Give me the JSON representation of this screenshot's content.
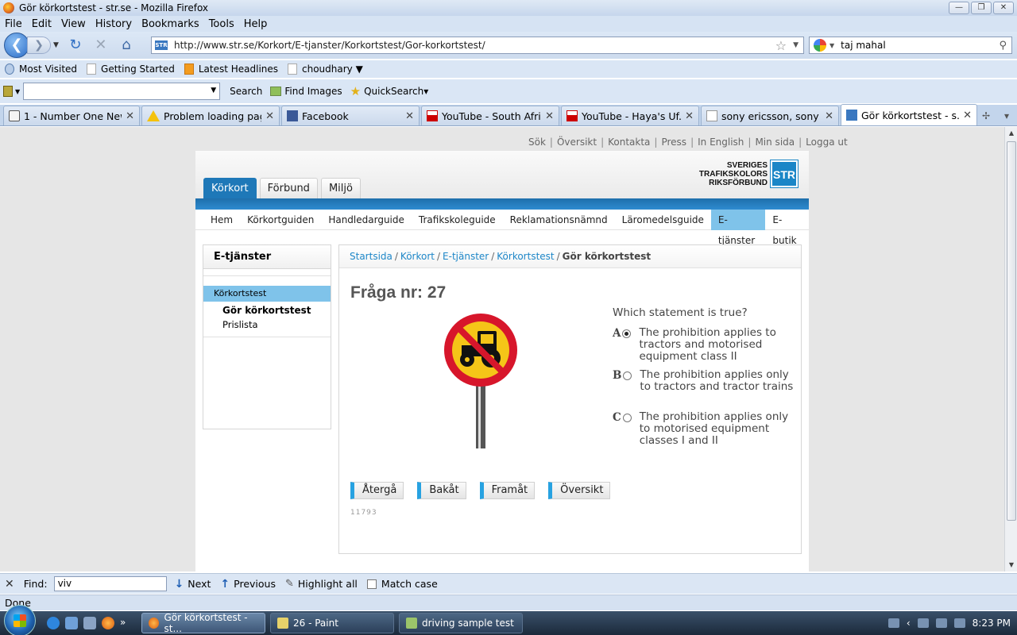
{
  "window": {
    "title": "Gör körkortstest - str.se - Mozilla Firefox",
    "buttons": [
      "minimize",
      "maximize",
      "close"
    ]
  },
  "menu": [
    "File",
    "Edit",
    "View",
    "History",
    "Bookmarks",
    "Tools",
    "Help"
  ],
  "nav": {
    "url": "http://www.str.se/Korkort/E-tjanster/Korkortstest/Gor-korkortstest/",
    "search_value": "taj mahal",
    "site_icon_text": "STR"
  },
  "bookmarks": [
    "Most Visited",
    "Getting Started",
    "Latest Headlines",
    "choudhary ▼"
  ],
  "toolbar2": {
    "search": "Search",
    "find_images": "Find Images",
    "quicksearch": "QuickSearch▾"
  },
  "tabs": [
    {
      "label": "1 - Number One New...",
      "icon": "hand-icon"
    },
    {
      "label": "Problem loading page",
      "icon": "warning-icon"
    },
    {
      "label": "Facebook",
      "icon": "facebook-icon"
    },
    {
      "label": "YouTube - South Afri...",
      "icon": "youtube-icon"
    },
    {
      "label": "YouTube - Haya's Uf...",
      "icon": "youtube-icon"
    },
    {
      "label": "sony ericsson, sony e...",
      "icon": "document-icon"
    },
    {
      "label": "Gör körkortstest - s...",
      "icon": "str-icon",
      "active": true
    }
  ],
  "site": {
    "toplinks": [
      "Sök",
      "Översikt",
      "Kontakta",
      "Press",
      "In English",
      "Min sida",
      "Logga ut"
    ],
    "logo": {
      "line1": "SVERIGES",
      "line2": "TRAFIKSKOLORS",
      "line3": "RIKSFÖRBUND",
      "mark": "STR"
    },
    "main_tabs": [
      "Körkort",
      "Förbund",
      "Miljö"
    ],
    "subnav": [
      "Hem",
      "Körkortguiden",
      "Handledarguide",
      "Trafikskoleguide",
      "Reklamationsnämnd",
      "Läromedelsguide",
      "E-tjänster",
      "E-butik"
    ],
    "sidebar": {
      "heading": "E-tjänster",
      "selected": "Körkortstest",
      "items": [
        "Gör körkortstest",
        "Prislista"
      ]
    },
    "breadcrumb": [
      "Startsida",
      "Körkort",
      "E-tjänster",
      "Körkortstest",
      "Gör körkortstest"
    ],
    "question": {
      "title": "Fråga nr: 27",
      "text": "Which statement is true?",
      "options": [
        {
          "letter": "A",
          "text": "The prohibition applies to tractors and motorised equipment class II",
          "checked": true
        },
        {
          "letter": "B",
          "text": "The prohibition applies only to tractors and tractor trains",
          "checked": false
        },
        {
          "letter": "C",
          "text": "The prohibition applies only to motorised equipment classes I and II",
          "checked": false
        }
      ],
      "buttons": [
        "Återgå",
        "Bakåt",
        "Framåt",
        "Översikt"
      ],
      "id": "11793"
    }
  },
  "findbar": {
    "label": "Find:",
    "value": "viv",
    "next": "Next",
    "previous": "Previous",
    "highlight": "Highlight all",
    "match_case": "Match case"
  },
  "status": "Done",
  "taskbar": {
    "tasks": [
      "Gör körkortstest - st...",
      "26 - Paint",
      "driving sample test"
    ],
    "time": "8:23 PM"
  },
  "colors": {
    "accent": "#1e78b8",
    "highlight": "#7fc3ea",
    "link": "#1e87c8",
    "button_accent": "#27a2e1"
  }
}
